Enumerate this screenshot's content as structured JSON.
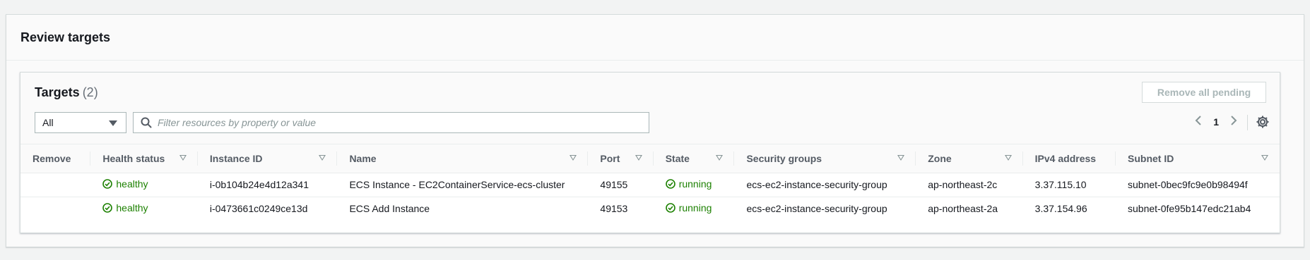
{
  "panel": {
    "title": "Review targets"
  },
  "targets": {
    "title": "Targets",
    "count": "(2)",
    "remove_all_label": "Remove all pending",
    "filter": {
      "selected": "All"
    },
    "search": {
      "placeholder": "Filter resources by property or value",
      "value": ""
    },
    "pagination": {
      "current_page": "1"
    }
  },
  "table": {
    "columns": [
      "Remove",
      "Health status",
      "Instance ID",
      "Name",
      "Port",
      "State",
      "Security groups",
      "Zone",
      "IPv4 address",
      "Subnet ID"
    ],
    "rows": [
      {
        "remove": "",
        "health": "healthy",
        "instance_id": "i-0b104b24e4d12a341",
        "name": "ECS Instance - EC2ContainerService-ecs-cluster",
        "port": "49155",
        "state": "running",
        "security_groups": "ecs-ec2-instance-security-group",
        "zone": "ap-northeast-2c",
        "ipv4": "3.37.115.10",
        "subnet_id": "subnet-0bec9fc9e0b98494f"
      },
      {
        "remove": "",
        "health": "healthy",
        "instance_id": "i-0473661c0249ce13d",
        "name": "ECS Add Instance",
        "port": "49153",
        "state": "running",
        "security_groups": "ecs-ec2-instance-security-group",
        "zone": "ap-northeast-2a",
        "ipv4": "3.37.154.96",
        "subnet_id": "subnet-0fe95b147edc21ab4"
      }
    ]
  },
  "icons": {
    "status_ok": "check-circle-icon",
    "search": "search-icon",
    "settings": "gear-icon",
    "prev": "chevron-left-icon",
    "next": "chevron-right-icon",
    "sort": "caret-down-icon"
  },
  "colors": {
    "success": "#1d8102",
    "accent_muted": "#aab7b8"
  }
}
